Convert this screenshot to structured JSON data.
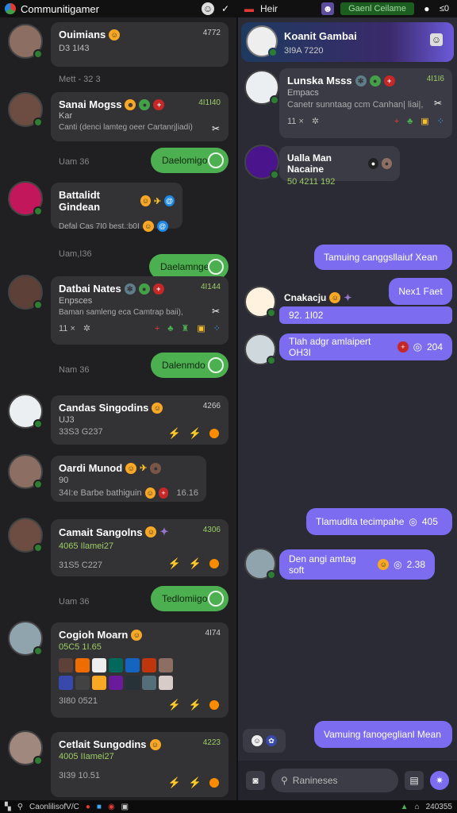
{
  "window": {
    "title": "Communitigamer",
    "right_tab": "Heir",
    "right_pill": "Gaenl Ceilame",
    "right_count": "≤0"
  },
  "left": {
    "items": [
      {
        "name": "Ouimians",
        "sub": "D3 1I43",
        "time": "4772",
        "stamp": "Mett - 32 3"
      },
      {
        "name": "Sanai Mogss",
        "sub": "Kar",
        "line": "Canti (denci lamteg oeer Cartanrj|iadi)",
        "time": "4I1I40",
        "stamp": "Uam 36",
        "button": "Daelomigo"
      },
      {
        "name": "Battalidt Gindean",
        "line": "Defal Cas 7I0 best.:b0I",
        "stamp": "Uam,I36",
        "button": "Daelamnge"
      },
      {
        "name": "Datbai Nates",
        "sub": "Enpsces",
        "line": "Baman samleng eca Camtrap baii),",
        "count": "11 ×",
        "time": "4I144",
        "stamp": "Nam 36",
        "button": "Dalenmdo"
      },
      {
        "name": "Candas Singodins",
        "sub": "UJ3",
        "line": "33S3 G237",
        "time": "4266"
      },
      {
        "name": "Oardi Munod",
        "sub": "90",
        "line": "34I:e Barbe bathiguin",
        "time": "16.16"
      },
      {
        "name": "Camait Sangolns",
        "sub": "4065 Ilamei27",
        "line": "31S5 C227",
        "time": "4306",
        "stamp": "Uam 36",
        "button": "Tedlomiigo"
      },
      {
        "name": "Cogioh Moarn",
        "sub": "05C5 1I.65",
        "line": "3I80 0521",
        "time": "4I74"
      },
      {
        "name": "Cetlait Sungodins",
        "sub": "4005 IIamei27",
        "line": "3I39 10.51",
        "time": "4223"
      }
    ]
  },
  "right": {
    "header": {
      "name": "Koanit Gambai",
      "sub": "3I9A 7220"
    },
    "card1": {
      "name": "Lunska Msss",
      "sub": "Empacs",
      "line": "Canetr sunntaag ccm Canhan| liai|,",
      "count": "11 ×",
      "time": "4I1I6"
    },
    "card2": {
      "name": "Ualla Man Nacaine",
      "sub": "50 4211 192"
    },
    "bubble1": "Tamuing canggsllaiuf Xean",
    "bubble2": "Nex1 Faet",
    "card3": {
      "name": "Cnakacju",
      "sub": "92. 1I02"
    },
    "card4": {
      "line": "Tlah adgr amlaipert OH3I",
      "time": "204"
    },
    "bubble3": {
      "text": "Tlamudita tecimpahe",
      "time": "405"
    },
    "card5": {
      "line": "Den angi amtag soft",
      "time": "2.38"
    },
    "bubble4": "Vamuing fanogeglianl Mean",
    "search_placeholder": "Ranineses"
  },
  "taskbar": {
    "search": "CaonlilisofV/C",
    "clock": "240355"
  }
}
